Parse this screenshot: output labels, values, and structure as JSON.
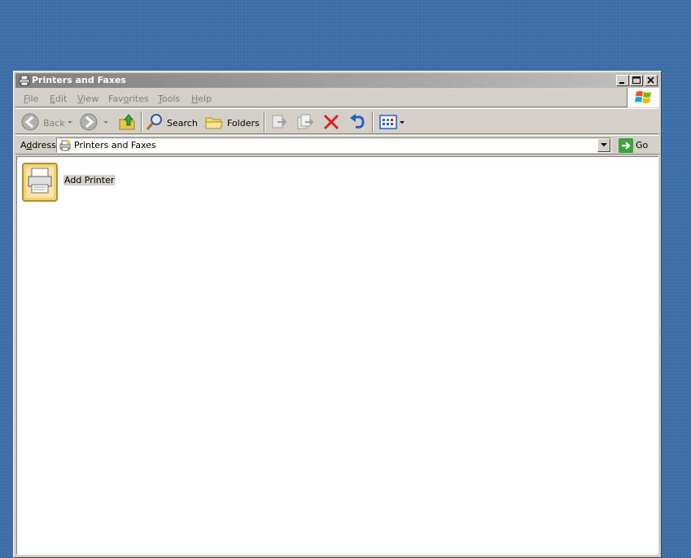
{
  "window": {
    "title": "Printers and Faxes"
  },
  "menu": {
    "items": [
      {
        "label": "File",
        "accel": "F",
        "rest": "ile"
      },
      {
        "label": "Edit",
        "accel": "E",
        "rest": "dit"
      },
      {
        "label": "View",
        "accel": "V",
        "rest": "iew"
      },
      {
        "label": "Favorites",
        "accel": "F",
        "rest": "avorites",
        "prefix": "Fav",
        "accel2": "o",
        "rest2": "rites"
      },
      {
        "label": "Tools",
        "accel": "T",
        "rest": "ools"
      },
      {
        "label": "Help",
        "accel": "H",
        "rest": "elp"
      }
    ]
  },
  "toolbar": {
    "back_label": "Back",
    "search_label": "Search",
    "folders_label": "Folders"
  },
  "address": {
    "label": "Address",
    "label_accel": "d",
    "value": "Printers and Faxes",
    "go_label": "Go"
  },
  "content": {
    "items": [
      {
        "label": "Add Printer",
        "icon": "add-printer-icon"
      }
    ]
  },
  "colors": {
    "desktop": "#3a6ea5",
    "titlebar_inactive_start": "#808080",
    "titlebar_inactive_end": "#c0c0c0",
    "face": "#d4d0c8"
  }
}
